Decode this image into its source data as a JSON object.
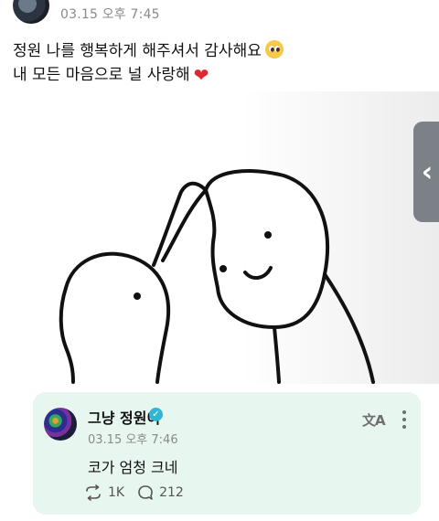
{
  "post": {
    "time": "03.15 오후 7:45",
    "line1": "정원 나를 행복하게 해주셔서 감사해요",
    "line2": "내 모든 마음으로 널 사랑해",
    "heart": "❤"
  },
  "side_handle": {
    "glyph": "‹"
  },
  "quote": {
    "author": "그냥 정원이",
    "verified_mark": "✓",
    "time": "03.15 오후 7:46",
    "translate_glyph": "文A",
    "text": "코가 엄청 크네",
    "repost_count": "1K",
    "reply_count": "212"
  },
  "colors": {
    "quote_background": "#e8f6f0",
    "verified": "#2fb6d6",
    "heart": "#e0262e",
    "side_handle": "#7c8187"
  }
}
